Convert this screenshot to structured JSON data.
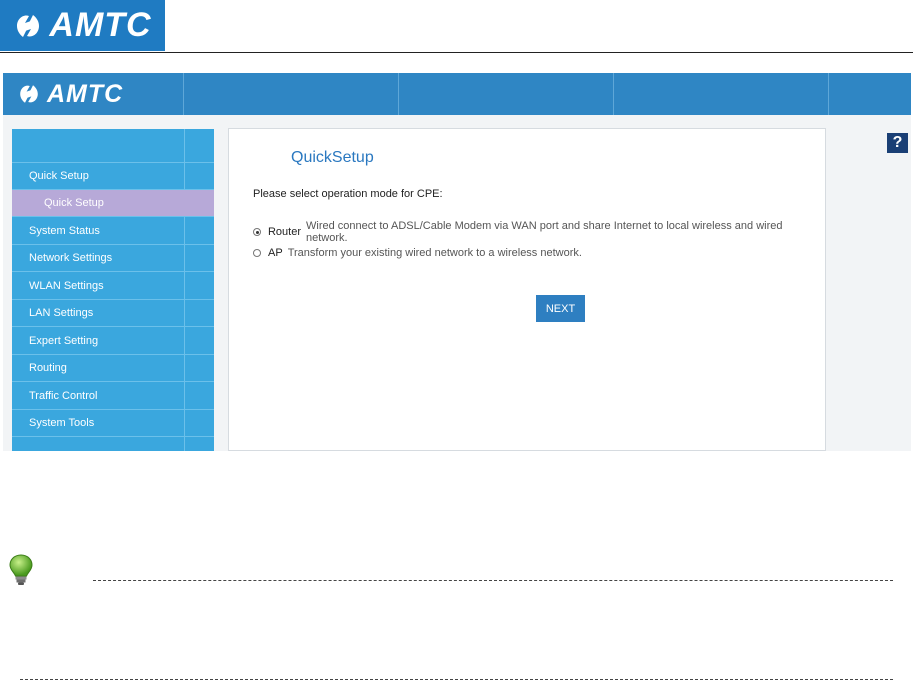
{
  "brand": {
    "logo_text": "AMTC"
  },
  "topbar": {
    "logo_text": "AMTC"
  },
  "sidebar": {
    "items": [
      {
        "label": "Quick Setup",
        "active": false
      },
      {
        "label": "Quick Setup",
        "active": true
      },
      {
        "label": "System Status",
        "active": false
      },
      {
        "label": "Network Settings",
        "active": false
      },
      {
        "label": "WLAN Settings",
        "active": false
      },
      {
        "label": "LAN Settings",
        "active": false
      },
      {
        "label": "Expert Setting",
        "active": false
      },
      {
        "label": "Routing",
        "active": false
      },
      {
        "label": "Traffic Control",
        "active": false
      },
      {
        "label": "System Tools",
        "active": false
      }
    ]
  },
  "main": {
    "title": "QuickSetup",
    "prompt": "Please select operation mode for CPE:",
    "options": [
      {
        "name": "Router",
        "description": "Wired connect to ADSL/Cable Modem via WAN port and share Internet to local wireless and wired network.",
        "selected": true
      },
      {
        "name": "AP",
        "description": "Transform your existing wired network to a wireless network.",
        "selected": false
      }
    ],
    "next_label": "NEXT"
  },
  "help": {
    "label": "?"
  },
  "icons": {
    "help": "question-icon",
    "note": "lightbulb-icon",
    "logo": "amtc-logo-mark"
  },
  "colors": {
    "brand_blue": "#1f7bc2",
    "sidebar_blue": "#3aa7de",
    "active_item": "#b7a9d8",
    "title_blue": "#2a78c0"
  }
}
